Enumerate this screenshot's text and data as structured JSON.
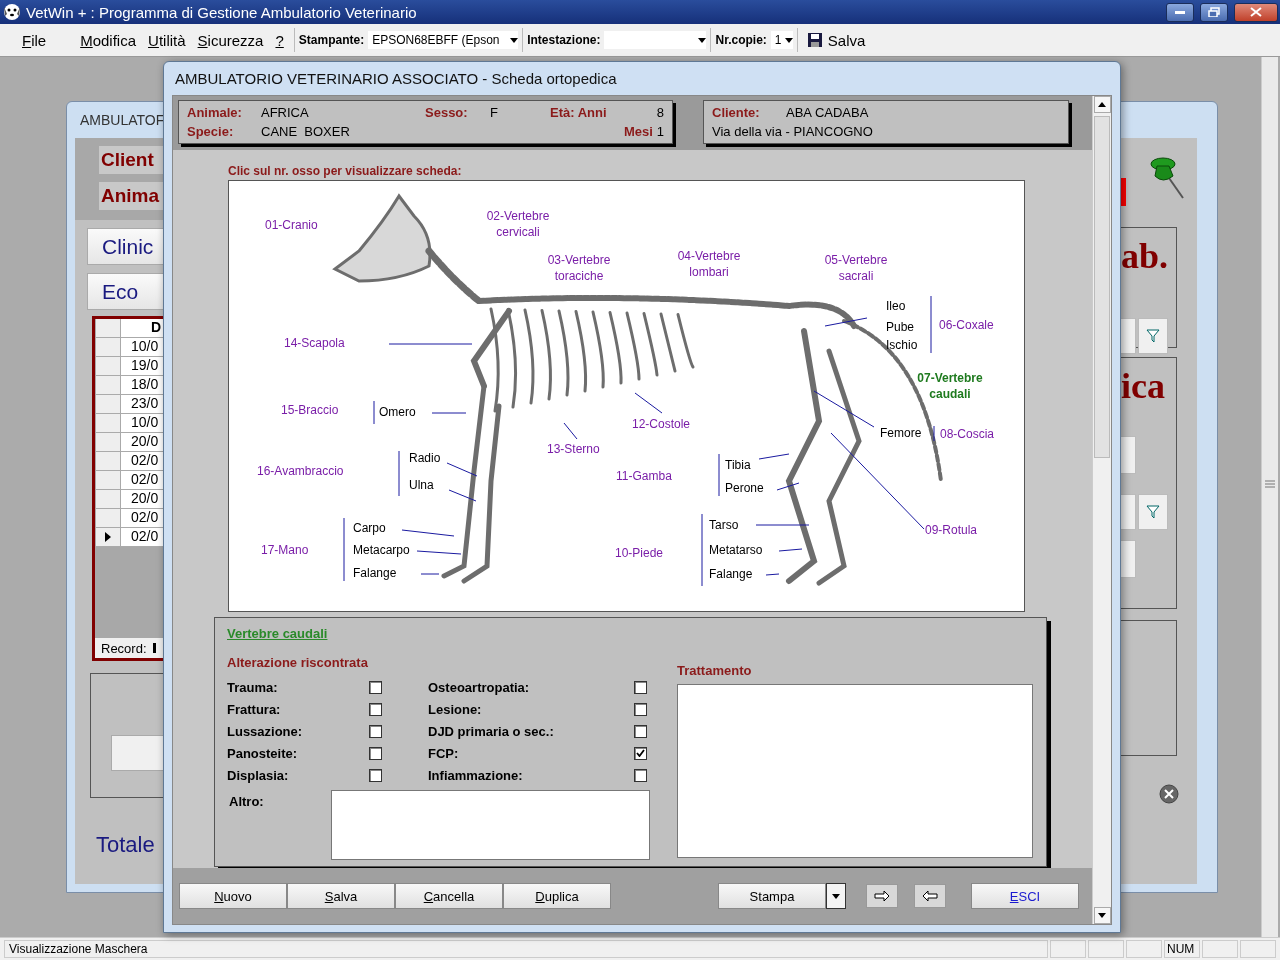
{
  "app": {
    "title": "VetWin + : Programma di Gestione Ambulatorio Veterinario"
  },
  "menu": [
    "File",
    "Modifica",
    "Utilità",
    "Sicurezza",
    "?"
  ],
  "toolbar": {
    "printer_label": "Stampante:",
    "printer": "EPSON68EBFF (Epson",
    "header_label": "Intestazione:",
    "copies_label": "Nr.copie:",
    "copies": "1",
    "save": "Salva"
  },
  "background_window": {
    "title": "AMBULATOF",
    "labels": [
      "Client",
      "Anima"
    ],
    "buttons": [
      "Clinic",
      "Eco"
    ],
    "table_column": "D",
    "rows": [
      {
        "date": "10/0",
        "selected": false
      },
      {
        "date": "19/0",
        "selected": false
      },
      {
        "date": "18/0",
        "selected": false
      },
      {
        "date": "23/0",
        "selected": false
      },
      {
        "date": "10/0",
        "selected": false
      },
      {
        "date": "20/0",
        "selected": false
      },
      {
        "date": "02/0",
        "selected": false
      },
      {
        "date": "02/0",
        "selected": false
      },
      {
        "date": "20/0",
        "selected": false
      },
      {
        "date": "02/0",
        "selected": false
      },
      {
        "date": "02/0",
        "selected": true
      }
    ],
    "record_label": "Record:",
    "total_label": "Totale",
    "headings": [
      "ab.",
      "ica"
    ]
  },
  "dialog": {
    "title": "AMBULATORIO VETERINARIO ASSOCIATO - Scheda ortopedica",
    "animal": {
      "name_label": "Animale:",
      "name": "AFRICA",
      "sex_label": "Sesso:",
      "sex": "F",
      "age_label": "Età: Anni",
      "years": "8",
      "species_label": "Specie:",
      "species": "CANE  BOXER",
      "months_label": "Mesi",
      "months": "1"
    },
    "client": {
      "label": "Cliente:",
      "name": "ABA CADABA",
      "address": "Via della via - PIANCOGNO"
    },
    "diagram_hint": "Clic sul nr. osso per visualizzare scheda:",
    "bones": [
      {
        "text": "01-Cranio",
        "kind": "bone",
        "selected": false
      },
      {
        "text": "02-Vertebre cervicali",
        "kind": "bone",
        "selected": false
      },
      {
        "text": "03-Vertebre toraciche",
        "kind": "bone",
        "selected": false
      },
      {
        "text": "04-Vertebre lombari",
        "kind": "bone",
        "selected": false
      },
      {
        "text": "05-Vertebre sacrali",
        "kind": "bone",
        "selected": false
      },
      {
        "text": "Ileo",
        "kind": "part"
      },
      {
        "text": "Pube",
        "kind": "part"
      },
      {
        "text": "Ischio",
        "kind": "part"
      },
      {
        "text": "06-Coxale",
        "kind": "bone",
        "selected": false
      },
      {
        "text": "07-Vertebre caudali",
        "kind": "bone",
        "selected": true
      },
      {
        "text": "14-Scapola",
        "kind": "bone",
        "selected": false
      },
      {
        "text": "15-Braccio",
        "kind": "bone",
        "selected": false
      },
      {
        "text": "Omero",
        "kind": "part"
      },
      {
        "text": "12-Costole",
        "kind": "bone",
        "selected": false
      },
      {
        "text": "Femore",
        "kind": "part"
      },
      {
        "text": "08-Coscia",
        "kind": "bone",
        "selected": false
      },
      {
        "text": "13-Sterno",
        "kind": "bone",
        "selected": false
      },
      {
        "text": "16-Avambraccio",
        "kind": "bone",
        "selected": false
      },
      {
        "text": "Radio",
        "kind": "part"
      },
      {
        "text": "Ulna",
        "kind": "part"
      },
      {
        "text": "11-Gamba",
        "kind": "bone",
        "selected": false
      },
      {
        "text": "Tibia",
        "kind": "part"
      },
      {
        "text": "Perone",
        "kind": "part"
      },
      {
        "text": "Carpo",
        "kind": "part"
      },
      {
        "text": "Tarso",
        "kind": "part"
      },
      {
        "text": "09-Rotula",
        "kind": "bone",
        "selected": false
      },
      {
        "text": "17-Mano",
        "kind": "bone",
        "selected": false
      },
      {
        "text": "Metacarpo",
        "kind": "part"
      },
      {
        "text": "10-Piede",
        "kind": "bone",
        "selected": false
      },
      {
        "text": "Metatarso",
        "kind": "part"
      },
      {
        "text": "Falange",
        "kind": "part"
      },
      {
        "text": "Falange",
        "kind": "part"
      }
    ],
    "form": {
      "title": "Vertebre caudali",
      "findings_label": "Alterazione riscontrata",
      "findings": [
        {
          "label": "Trauma:",
          "checked": false
        },
        {
          "label": "Frattura:",
          "checked": false
        },
        {
          "label": "Lussazione:",
          "checked": false
        },
        {
          "label": "Panosteite:",
          "checked": false
        },
        {
          "label": "Displasia:",
          "checked": false
        },
        {
          "label": "Osteoartropatia:",
          "checked": false
        },
        {
          "label": "Lesione:",
          "checked": false
        },
        {
          "label": "DJD primaria o sec.:",
          "checked": false
        },
        {
          "label": "FCP:",
          "checked": true
        },
        {
          "label": "Infiammazione:",
          "checked": false
        }
      ],
      "other_label": "Altro:",
      "treatment_label": "Trattamento"
    },
    "buttons": [
      "Nuovo",
      "Salva",
      "Cancella",
      "Duplica"
    ],
    "print_button": "Stampa",
    "exit_button": "ESCI"
  },
  "status_bar": {
    "text": "Visualizzazione Maschera",
    "indicator": "NUM"
  }
}
